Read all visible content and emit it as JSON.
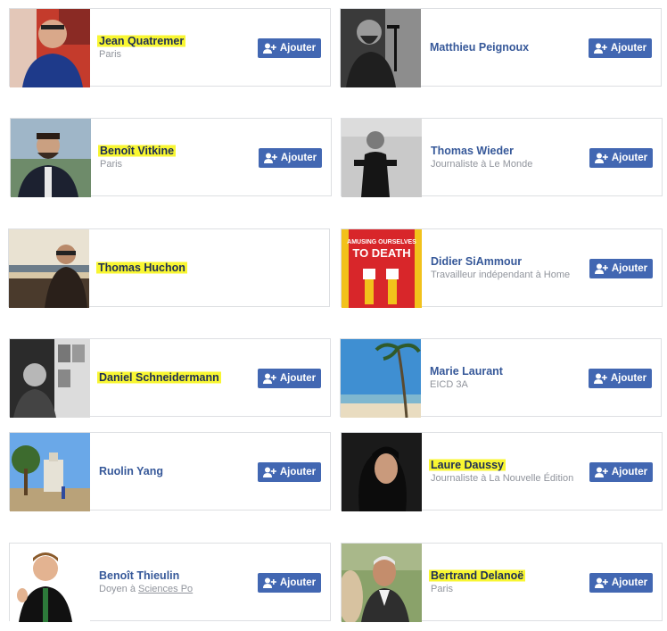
{
  "add_label": "Ajouter",
  "colors": {
    "link": "#365899",
    "button": "#4267b2",
    "highlight": "#f8f632",
    "subtext": "#90949c"
  },
  "icons": {
    "add_friend": "add-friend-icon"
  },
  "suggestions": [
    {
      "name": "Jean Quatremer",
      "subtitle": "Paris",
      "highlighted": true,
      "has_button": true
    },
    {
      "name": "Matthieu Peignoux",
      "subtitle": "",
      "highlighted": false,
      "has_button": true
    },
    {
      "name": "Benoît Vitkine",
      "subtitle": "Paris",
      "highlighted": true,
      "has_button": true
    },
    {
      "name": "Thomas Wieder",
      "subtitle": "Journaliste à Le Monde",
      "highlighted": false,
      "has_button": true
    },
    {
      "name": "Thomas Huchon",
      "subtitle": "",
      "highlighted": true,
      "has_button": false
    },
    {
      "name": "Didier SiAmmour",
      "subtitle": "Travailleur indépendant à Home",
      "highlighted": false,
      "has_button": true
    },
    {
      "name": "Daniel Schneidermann",
      "subtitle": "",
      "highlighted": true,
      "has_button": true
    },
    {
      "name": "Marie Laurant",
      "subtitle": "EICD 3A",
      "highlighted": false,
      "has_button": true
    },
    {
      "name": "Ruolin Yang",
      "subtitle": "",
      "highlighted": false,
      "has_button": true
    },
    {
      "name": "Laure Daussy",
      "subtitle": "Journaliste à La Nouvelle Édition",
      "highlighted": true,
      "has_button": true
    },
    {
      "name": "Benoît Thieulin",
      "subtitle_prefix": "Doyen à ",
      "subtitle_link": "Sciences Po",
      "highlighted": false,
      "has_button": true
    },
    {
      "name": "Bertrand Delanoë",
      "subtitle": "Paris",
      "highlighted": true,
      "has_button": true
    }
  ],
  "book_cover": {
    "line1": "AMUSING OURSELVES",
    "line2": "TO DEATH"
  }
}
